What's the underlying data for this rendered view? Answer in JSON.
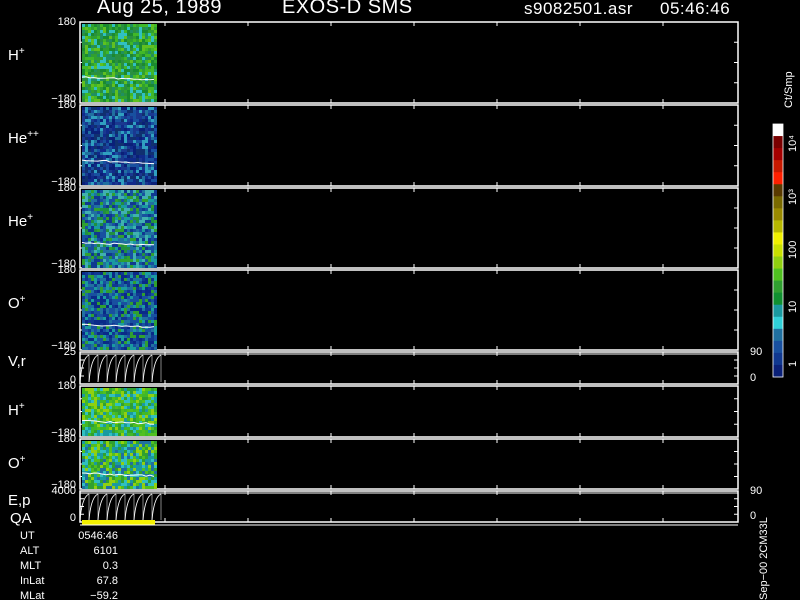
{
  "header": {
    "date": "Aug 25, 1989",
    "instrument": "EXOS-D SMS",
    "file": "s9082501.asr",
    "time": "05:46:46"
  },
  "panels": [
    {
      "base": "H",
      "sup": "+",
      "top_tick": "180",
      "bottom_tick": "−180"
    },
    {
      "base": "He",
      "sup": "++",
      "top_tick": "180",
      "bottom_tick": "−180"
    },
    {
      "base": "He",
      "sup": "+",
      "top_tick": "180",
      "bottom_tick": "−180"
    },
    {
      "base": "O",
      "sup": "+",
      "top_tick": "180",
      "bottom_tick": "−180"
    },
    {
      "base": "V,r",
      "sup": "",
      "top_tick": "25",
      "bottom_tick": "0",
      "right_top": "90",
      "right_bottom": "0"
    },
    {
      "base": "H",
      "sup": "+",
      "top_tick": "180",
      "bottom_tick": "−180"
    },
    {
      "base": "O",
      "sup": "+",
      "top_tick": "180",
      "bottom_tick": "−180"
    },
    {
      "base": "E,p",
      "sup": "",
      "top_tick": "4000",
      "bottom_tick": "0",
      "right_top": "90",
      "right_bottom": "0"
    }
  ],
  "qa_label": "QA",
  "info": [
    {
      "key": "UT",
      "value": "0546:46"
    },
    {
      "key": "ALT",
      "value": "6101"
    },
    {
      "key": "MLT",
      "value": "0.3"
    },
    {
      "key": "InLat",
      "value": "67.8"
    },
    {
      "key": "MLat",
      "value": "−59.2"
    }
  ],
  "colorbar": {
    "unit": "Ct/Smp",
    "tick_labels": [
      "10⁴",
      "10³",
      "100",
      "10",
      "1"
    ],
    "colors": [
      "#ffffff",
      "#7a0000",
      "#a30000",
      "#c81a00",
      "#ff2000",
      "#5a3a00",
      "#7a6a00",
      "#9a8a00",
      "#b8b800",
      "#f0f000",
      "#c8e000",
      "#90d010",
      "#50c020",
      "#30a030",
      "#109030",
      "#1a9aa0",
      "#30d0d8",
      "#2070a0",
      "#1850a0",
      "#103890",
      "#0a2078"
    ]
  },
  "footer_code": "Sep−00 2CM33L",
  "colors": {
    "qa_bar": "#f4f000",
    "trace": "#ffffff"
  }
}
